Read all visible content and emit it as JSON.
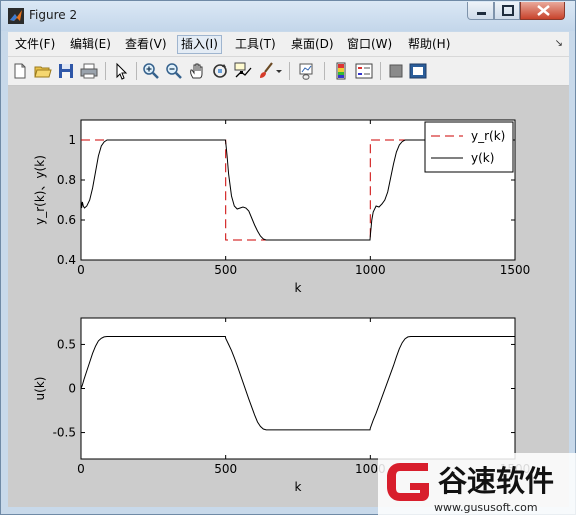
{
  "window": {
    "title": "Figure 2"
  },
  "menu": [
    {
      "label": "文件(F)"
    },
    {
      "label": "编辑(E)"
    },
    {
      "label": "查看(V)"
    },
    {
      "label": "插入(I)"
    },
    {
      "label": "工具(T)"
    },
    {
      "label": "桌面(D)"
    },
    {
      "label": "窗口(W)"
    },
    {
      "label": "帮助(H)"
    }
  ],
  "toolbar": [
    "new-figure-icon",
    "open-file-icon",
    "save-icon",
    "print-icon",
    "edit-plot-icon",
    "zoom-in-icon",
    "zoom-out-icon",
    "pan-icon",
    "rotate-3d-icon",
    "data-cursor-icon",
    "brush-icon",
    "link-plot-icon",
    "colorbar-icon",
    "legend-icon",
    "hide-plot-tools-icon",
    "show-plot-tools-icon"
  ],
  "colors": {
    "reference": "#cc0000",
    "output": "#000000",
    "figure_bg": "#cccccc",
    "axes_bg": "#ffffff"
  },
  "watermark": {
    "brand": "谷速软件",
    "url": "www.gususoft.com"
  },
  "chart_data": [
    {
      "type": "line",
      "xlabel": "k",
      "ylabel": "y_r(k)、y(k)",
      "xlim": [
        0,
        1500
      ],
      "ylim": [
        0.4,
        1.1
      ],
      "xticks": [
        0,
        500,
        1000,
        1500
      ],
      "yticks": [
        0.4,
        0.6,
        0.8,
        1
      ],
      "legend": "top-right",
      "series": [
        {
          "name": "y_r(k)",
          "style": "dashed",
          "color": "#cc0000",
          "x": [
            0,
            500,
            500,
            1000,
            1000,
            1500
          ],
          "y": [
            1,
            1,
            0.5,
            0.5,
            1,
            1
          ]
        },
        {
          "name": "y(k)",
          "style": "solid",
          "color": "#000000",
          "x": [
            0,
            2,
            5,
            8,
            12,
            20,
            30,
            40,
            50,
            60,
            70,
            80,
            90,
            100,
            150,
            200,
            300,
            400,
            499,
            500,
            505,
            510,
            520,
            530,
            540,
            550,
            560,
            570,
            580,
            590,
            600,
            610,
            620,
            630,
            640,
            700,
            800,
            900,
            999,
            1000,
            1005,
            1010,
            1020,
            1030,
            1040,
            1050,
            1060,
            1070,
            1080,
            1090,
            1100,
            1110,
            1120,
            1130,
            1140,
            1200,
            1300,
            1400,
            1500
          ],
          "y": [
            0.7,
            0.66,
            0.69,
            0.67,
            0.66,
            0.67,
            0.7,
            0.76,
            0.84,
            0.92,
            0.97,
            0.99,
            1.0,
            1.0,
            1.0,
            1.0,
            1.0,
            1.0,
            1.0,
            0.99,
            0.92,
            0.83,
            0.72,
            0.67,
            0.655,
            0.66,
            0.665,
            0.66,
            0.645,
            0.61,
            0.575,
            0.545,
            0.52,
            0.505,
            0.5,
            0.5,
            0.5,
            0.5,
            0.5,
            0.52,
            0.6,
            0.64,
            0.67,
            0.665,
            0.68,
            0.7,
            0.74,
            0.81,
            0.88,
            0.94,
            0.975,
            0.992,
            1.0,
            1.0,
            1.0,
            1.0,
            1.0,
            1.0,
            1.0
          ]
        }
      ]
    },
    {
      "type": "line",
      "xlabel": "k",
      "ylabel": "u(k)",
      "xlim": [
        0,
        1500
      ],
      "ylim": [
        -0.8,
        0.8
      ],
      "xticks": [
        0,
        500,
        1000,
        1500
      ],
      "yticks": [
        -0.5,
        0,
        0.5
      ],
      "series": [
        {
          "style": "solid",
          "color": "#000000",
          "x": [
            0,
            5,
            10,
            20,
            30,
            40,
            50,
            60,
            70,
            80,
            90,
            100,
            200,
            300,
            400,
            499,
            500,
            510,
            520,
            530,
            540,
            560,
            580,
            600,
            610,
            620,
            630,
            640,
            700,
            800,
            900,
            999,
            1000,
            1010,
            1020,
            1040,
            1060,
            1080,
            1090,
            1100,
            1110,
            1120,
            1130,
            1140,
            1200,
            1300,
            1400,
            1500
          ],
          "y": [
            0.0,
            0.04,
            0.1,
            0.2,
            0.3,
            0.4,
            0.48,
            0.54,
            0.57,
            0.585,
            0.59,
            0.59,
            0.59,
            0.59,
            0.59,
            0.59,
            0.57,
            0.5,
            0.43,
            0.35,
            0.26,
            0.07,
            -0.12,
            -0.3,
            -0.38,
            -0.43,
            -0.46,
            -0.47,
            -0.47,
            -0.47,
            -0.47,
            -0.47,
            -0.45,
            -0.36,
            -0.28,
            -0.1,
            0.08,
            0.26,
            0.36,
            0.45,
            0.52,
            0.565,
            0.585,
            0.59,
            0.59,
            0.59,
            0.59,
            0.59
          ]
        }
      ]
    }
  ]
}
